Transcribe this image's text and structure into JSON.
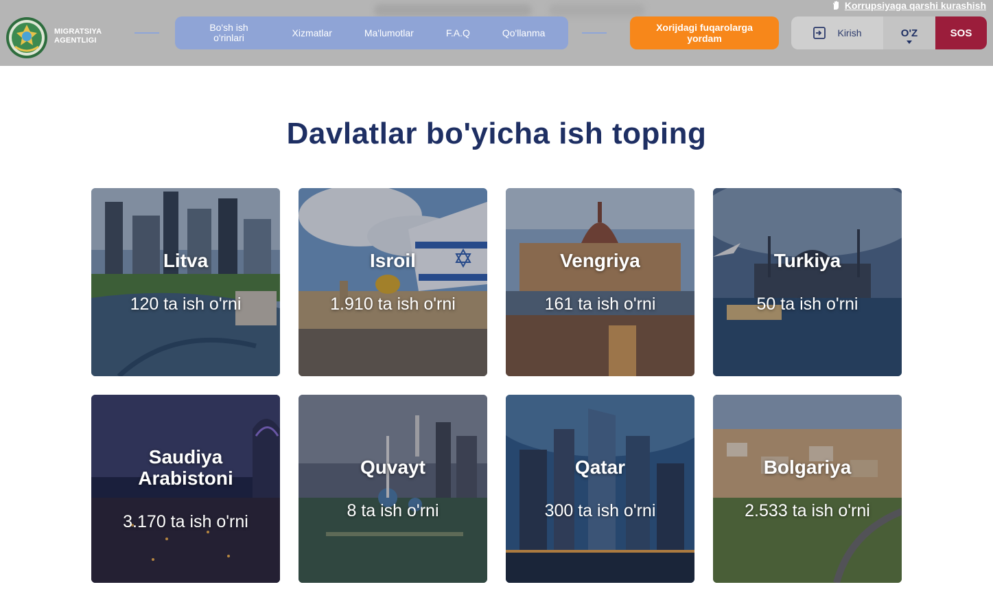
{
  "header": {
    "anti_corruption_link": "Korrupsiyaga qarshi kurashish",
    "brand_line1": "MIGRATSIYA",
    "brand_line2": "AGENTLIGI",
    "nav": [
      {
        "label": "Bo'sh ish o'rinlari"
      },
      {
        "label": "Xizmatlar"
      },
      {
        "label": "Ma'lumotlar"
      },
      {
        "label": "F.A.Q"
      },
      {
        "label": "Qo'llanma"
      }
    ],
    "help_button": "Xorijdagi fuqarolarga yordam",
    "login_button": "Kirish",
    "language": "O'Z",
    "sos_button": "SOS"
  },
  "main": {
    "title": "Davlatlar bo'yicha ish toping",
    "countries": [
      {
        "name": "Litva",
        "jobs": "120 ta ish o'rni"
      },
      {
        "name": "Isroil",
        "jobs": "1.910 ta ish o'rni"
      },
      {
        "name": "Vengriya",
        "jobs": "161 ta ish o'rni"
      },
      {
        "name": "Turkiya",
        "jobs": "50 ta ish o'rni"
      },
      {
        "name": "Saudiya Arabistoni",
        "jobs": "3.170 ta ish o'rni"
      },
      {
        "name": "Quvayt",
        "jobs": "8 ta ish o'rni"
      },
      {
        "name": "Qatar",
        "jobs": "300 ta ish o'rni"
      },
      {
        "name": "Bolgariya",
        "jobs": "2.533 ta ish o'rni"
      }
    ]
  },
  "colors": {
    "header_bg": "#b5b5b5",
    "nav_bg": "#8fa4d6",
    "help_button_bg": "#f7871a",
    "sos_bg": "#9b1d3b",
    "title_color": "#1e2f63"
  },
  "icons": {
    "anti_corruption": "hand-icon",
    "login": "login-icon",
    "language_dropdown": "chevron-down-icon"
  }
}
